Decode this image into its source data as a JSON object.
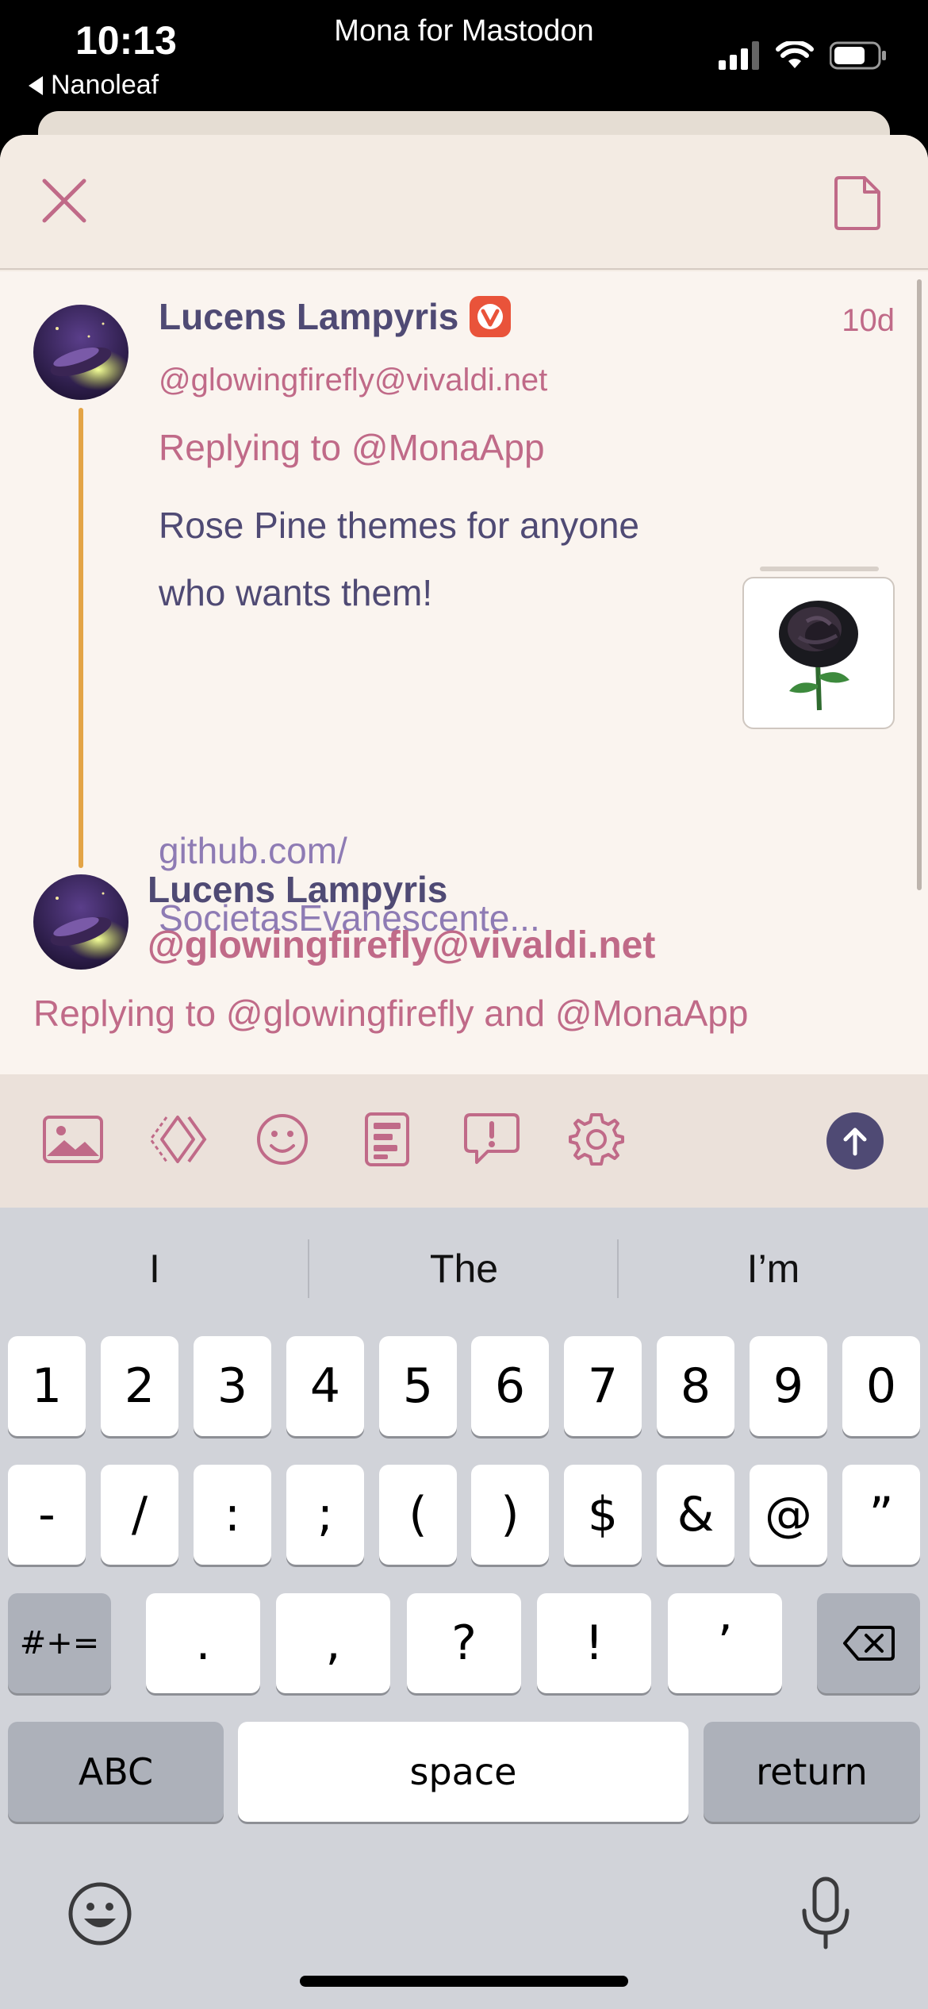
{
  "status_bar": {
    "time": "10:13",
    "back_app": "Nanoleaf",
    "title": "Mona for Mastodon"
  },
  "post": {
    "author_name": "Lucens Lampyris",
    "time_ago": "10d",
    "handle": "@glowingfirefly@vivaldi.net",
    "replying_to": "Replying to @MonaApp",
    "body_line1": "Rose Pine themes for anyone",
    "body_line2": "who wants them!",
    "link_line1": "github.com/",
    "link_line2": "SocietasEvanescente..."
  },
  "composer": {
    "account_name": "Lucens Lampyris",
    "account_handle": "@glowingfirefly@vivaldi.net",
    "replying_to": "Replying to @glowingfirefly and @MonaApp"
  },
  "toolbar": {
    "icons": [
      "image-icon",
      "gif-icon",
      "emoji-icon",
      "poll-icon",
      "content-warning-icon",
      "settings-icon",
      "send-icon"
    ]
  },
  "keyboard": {
    "suggestions": [
      "I",
      "The",
      "I’m"
    ],
    "row1": [
      "1",
      "2",
      "3",
      "4",
      "5",
      "6",
      "7",
      "8",
      "9",
      "0"
    ],
    "row2": [
      "-",
      "/",
      ":",
      ";",
      "(",
      ")",
      "$",
      "&",
      "@",
      "”"
    ],
    "row3": [
      "#+=",
      ".",
      ",",
      "?",
      "!",
      "’"
    ],
    "abc": "ABC",
    "space": "space",
    "return": "return"
  },
  "colors": {
    "accent_purple": "#4f4a74",
    "accent_pink": "#c06a88",
    "link_purple": "#8e7bb4",
    "thread_line": "#e3a446"
  }
}
